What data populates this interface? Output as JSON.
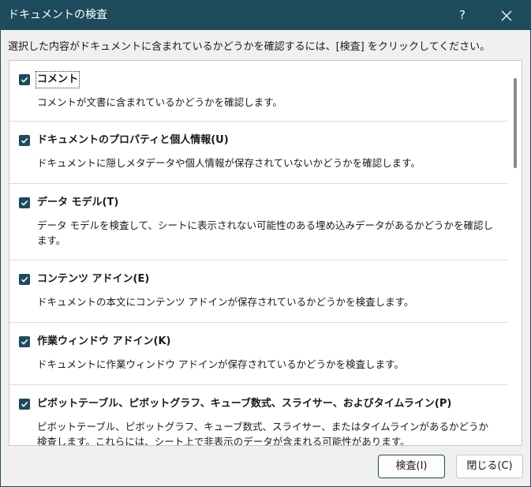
{
  "window": {
    "title": "ドキュメントの検査",
    "help_label": "?"
  },
  "instruction": "選択した内容がドキュメントに含まれているかどうかを確認するには、[検査] をクリックしてください。",
  "items": [
    {
      "title": "コメント",
      "description": "コメントが文書に含まれているかどうかを確認します。",
      "checked": true
    },
    {
      "title": "ドキュメントのプロパティと個人情報(U)",
      "description": "ドキュメントに隠しメタデータや個人情報が保存されていないかどうかを確認します。",
      "checked": true
    },
    {
      "title": "データ モデル(T)",
      "description": "データ モデルを検査して、シートに表示されない可能性のある埋め込みデータがあるかどうかを確認します。",
      "checked": true
    },
    {
      "title": "コンテンツ アドイン(E)",
      "description": "ドキュメントの本文にコンテンツ アドインが保存されているかどうかを検査します。",
      "checked": true
    },
    {
      "title": "作業ウィンドウ アドイン(K)",
      "description": "ドキュメントに作業ウィンドウ アドインが保存されているかどうかを検査します。",
      "checked": true
    },
    {
      "title": "ピボットテーブル、ピボットグラフ、キューブ数式、スライサー、およびタイムライン(P)",
      "description": "ピボットテーブル、ピボットグラフ、キューブ数式、スライサー、またはタイムラインがあるかどうか検査します。これらには、シート上で非表示のデータが含まれる可能性があります。",
      "checked": true
    }
  ],
  "buttons": {
    "inspect": "検査(I)",
    "close": "閉じる(C)"
  },
  "colors": {
    "titlebar": "#1e4b5c",
    "checkbox": "#1e4b5c"
  }
}
